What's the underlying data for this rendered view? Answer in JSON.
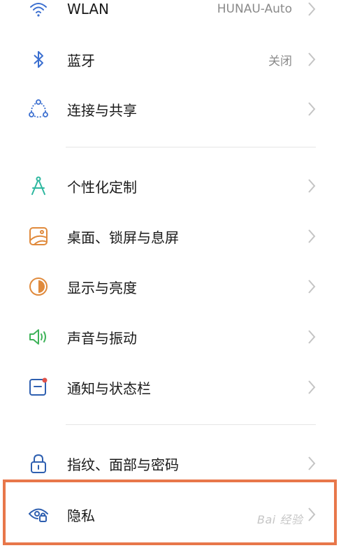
{
  "settings": {
    "items": [
      {
        "label": "WLAN",
        "value": "HUNAU-Auto",
        "icon": "wifi-icon"
      },
      {
        "label": "蓝牙",
        "value": "关闭",
        "icon": "bluetooth-icon"
      },
      {
        "label": "连接与共享",
        "value": "",
        "icon": "share-connection-icon"
      },
      {
        "label": "个性化定制",
        "value": "",
        "icon": "compass-personalize-icon"
      },
      {
        "label": "桌面、锁屏与息屏",
        "value": "",
        "icon": "wallpaper-icon"
      },
      {
        "label": "显示与亮度",
        "value": "",
        "icon": "brightness-icon"
      },
      {
        "label": "声音与振动",
        "value": "",
        "icon": "speaker-icon"
      },
      {
        "label": "通知与状态栏",
        "value": "",
        "icon": "notification-icon"
      },
      {
        "label": "指纹、面部与密码",
        "value": "",
        "icon": "lock-icon"
      },
      {
        "label": "隐私",
        "value": "",
        "icon": "privacy-eye-icon"
      }
    ]
  },
  "highlight_color": "#e8774a",
  "icon_colors": {
    "blue": "#3b6fd0",
    "teal": "#2fb8a0",
    "orange": "#e08a3c",
    "green": "#3fb35a",
    "navy": "#2e5fb0",
    "red": "#e0524a"
  },
  "watermark": "Bai 经验"
}
